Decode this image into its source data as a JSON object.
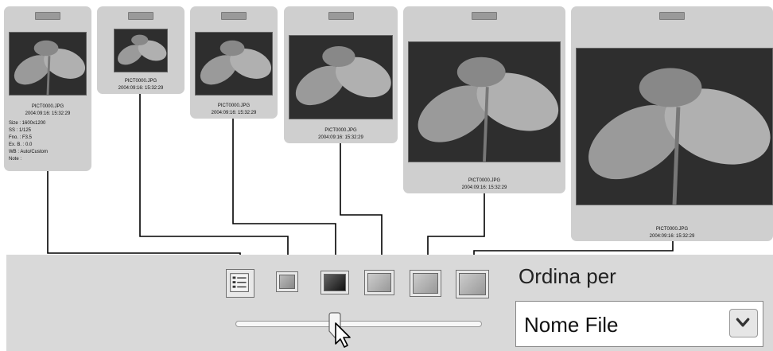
{
  "thumbnail": {
    "filename": "PICT0000.JPG",
    "datetime": "2004:09:16: 15:32:29",
    "details": [
      "Size : 1600x1200",
      "SS : 1/125",
      "Fno. : F3.5",
      "Ex. B. : 0.0",
      "WB : Auto/Custom",
      "Note :"
    ]
  },
  "toolbar": {
    "sort_label": "Ordina per",
    "sort_value": "Nome File",
    "view_buttons": [
      "list-view",
      "size-1",
      "size-2",
      "size-3",
      "size-4",
      "size-5"
    ],
    "slider_position": 0.4
  }
}
